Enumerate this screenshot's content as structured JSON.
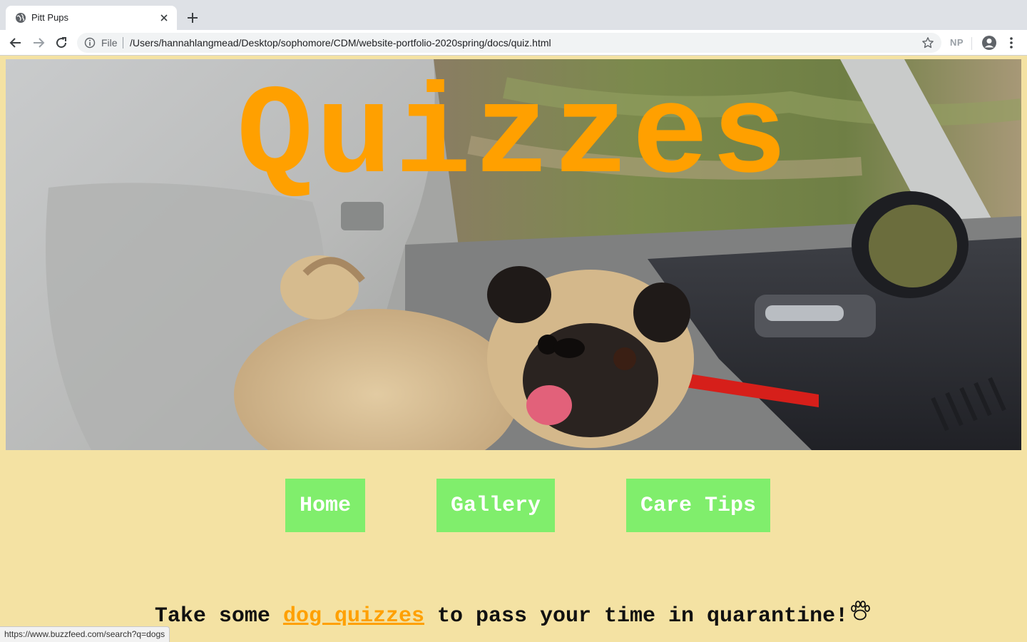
{
  "browser": {
    "tab_title": "Pitt Pups",
    "file_label": "File",
    "url": "/Users/hannahlangmead/Desktop/sophomore/CDM/website-portfolio-2020spring/docs/quiz.html",
    "extension_label": "NP",
    "status_url": "https://www.buzzfeed.com/search?q=dogs"
  },
  "hero": {
    "title": "Quizzes",
    "title_color": "#ffa000"
  },
  "nav": {
    "home": "Home",
    "gallery": "Gallery",
    "care_tips": "Care Tips",
    "button_color": "#80ee6c"
  },
  "content": {
    "tagline_before": "Take some ",
    "tagline_link": "dog quizzes",
    "tagline_after": " to pass your time in quarantine!",
    "paw_icon": "paw-icon"
  },
  "colors": {
    "page_background": "#f4e2a3",
    "link": "#ffa000"
  }
}
